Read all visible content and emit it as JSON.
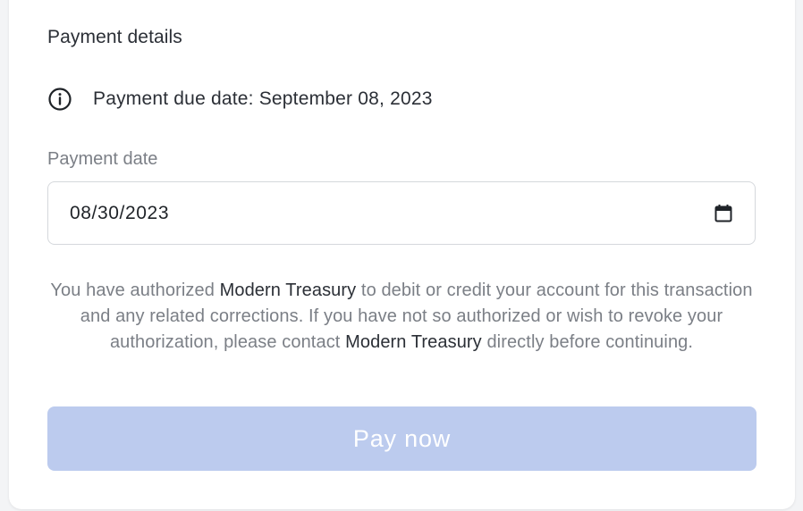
{
  "section": {
    "title": "Payment details"
  },
  "due": {
    "icon": "info-icon",
    "text": "Payment due date: September 08, 2023"
  },
  "payment_date": {
    "label": "Payment date",
    "value": "08/30/2023",
    "icon": "calendar-icon"
  },
  "authorization": {
    "part1": "You have authorized ",
    "company1": "Modern Treasury",
    "part2": " to debit or credit your account for this transaction and any related corrections. If you have not so authorized or wish to revoke your authorization, please contact ",
    "company2": "Modern Treasury",
    "part3": " directly before continuing."
  },
  "pay_button": {
    "label": "Pay now",
    "state": "disabled",
    "color": "#bccbee"
  }
}
